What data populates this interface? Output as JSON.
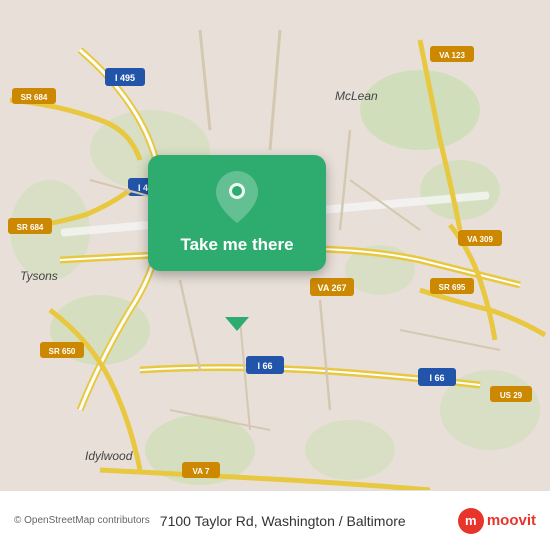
{
  "map": {
    "background_color": "#e8e0d8",
    "center_lat": 38.92,
    "center_lon": -77.18
  },
  "popup": {
    "button_label": "Take me there",
    "button_color": "#2eab6e",
    "pin_color": "#ffffff"
  },
  "bottom_bar": {
    "copyright": "© OpenStreetMap contributors",
    "address": "7100 Taylor Rd, Washington / Baltimore",
    "logo_text": "moovit"
  },
  "road_labels": [
    "SR 684",
    "I 495",
    "VA 123",
    "VA 267",
    "SR 684",
    "SR 695",
    "VA 309",
    "SR 650",
    "I 66",
    "VA 7",
    "US 29",
    "I 66",
    "McLean",
    "Tysons",
    "Idylwood"
  ]
}
